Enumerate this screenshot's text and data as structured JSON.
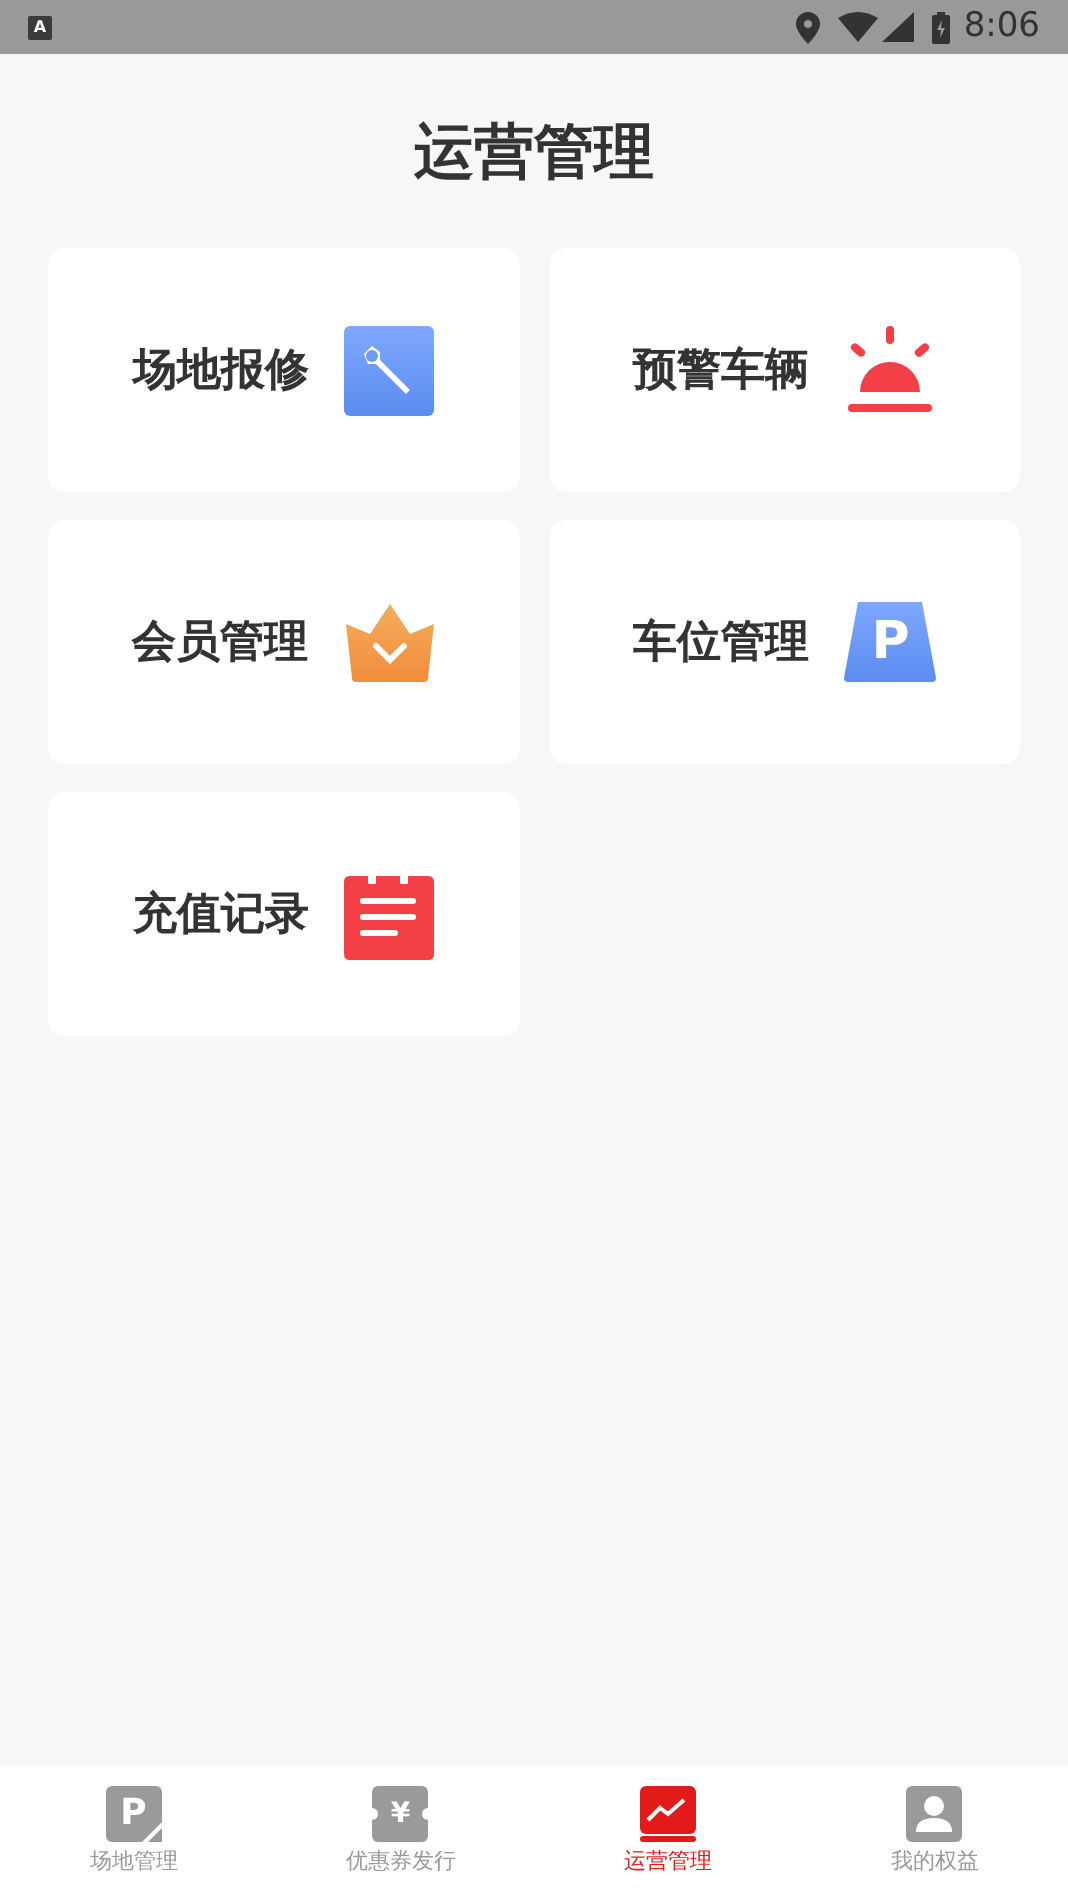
{
  "status_bar": {
    "app_glyph": "A",
    "time": "8:06"
  },
  "title": "运营管理",
  "cards": [
    {
      "label": "场地报修",
      "kind": "wrench"
    },
    {
      "label": "预警车辆",
      "kind": "alarm"
    },
    {
      "label": "会员管理",
      "kind": "crown"
    },
    {
      "label": "车位管理",
      "kind": "parking",
      "glyph": "P"
    },
    {
      "label": "充值记录",
      "kind": "notepad"
    }
  ],
  "tabs": [
    {
      "label": "场地管理",
      "kind": "parking",
      "glyph": "P",
      "selected": false
    },
    {
      "label": "优惠券发行",
      "kind": "coupon",
      "glyph": "¥",
      "selected": false
    },
    {
      "label": "运营管理",
      "kind": "chart",
      "selected": true
    },
    {
      "label": "我的权益",
      "kind": "person",
      "selected": false
    }
  ]
}
